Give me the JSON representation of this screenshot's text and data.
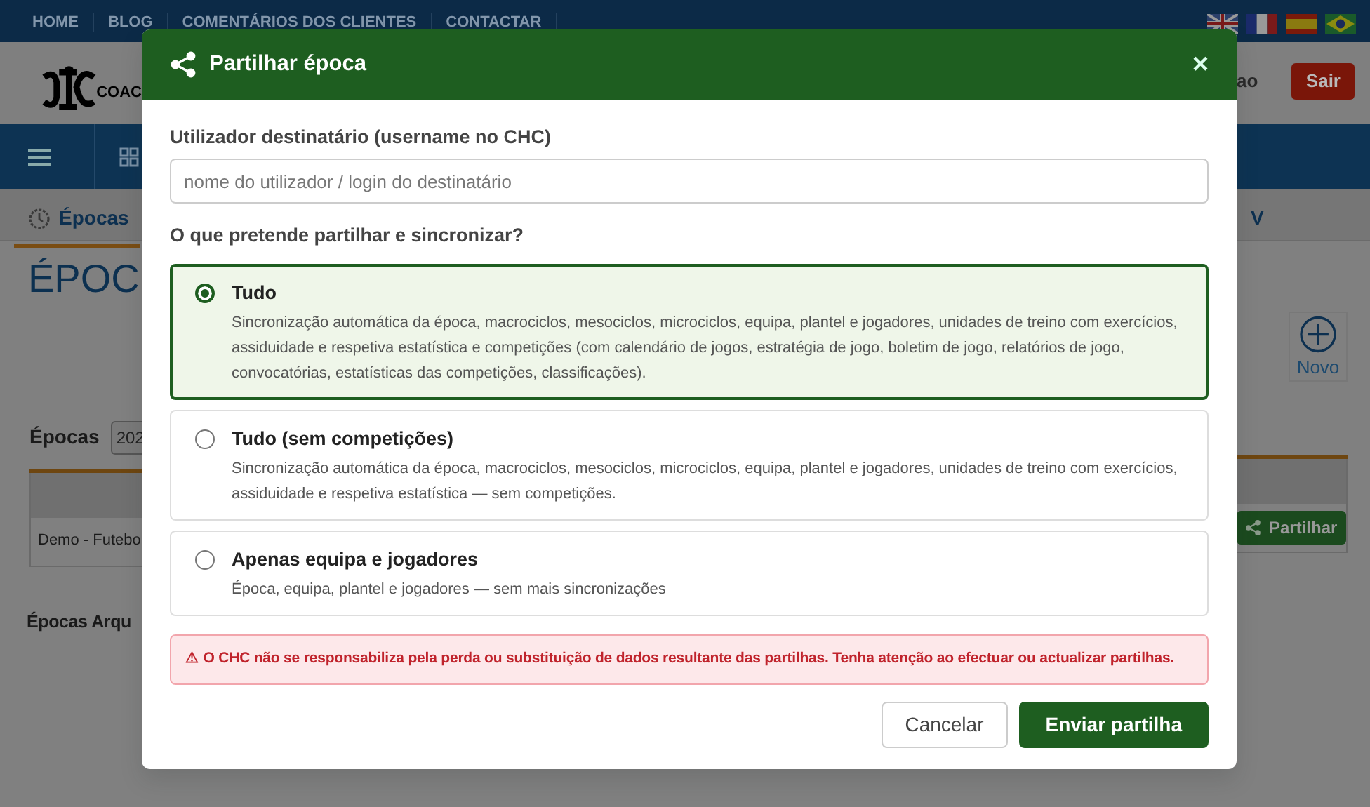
{
  "top_nav": {
    "links": [
      "HOME",
      "BLOG",
      "COMENTÁRIOS DOS CLIENTES",
      "CONTACTAR"
    ]
  },
  "header": {
    "logo_text": "COAC",
    "user_text": "ao",
    "logout_button": "Sair"
  },
  "tabs": [
    {
      "label": "Épocas",
      "selected": true
    },
    {
      "label": "V",
      "selected": false
    }
  ],
  "page": {
    "heading": "ÉPOC",
    "new_button": "Novo",
    "season_label": "Épocas",
    "season_select": "202",
    "table": {
      "rows": [
        {
          "name": "Demo - Futebo",
          "action": "Partilhar"
        }
      ]
    },
    "archived_heading": "Épocas Arqu"
  },
  "modal": {
    "title": "Partilhar época",
    "close": "×",
    "recipient": {
      "label": "Utilizador destinatário (username no CHC)",
      "placeholder": "nome do utilizador / login do destinatário"
    },
    "options_label": "O que pretende partilhar e sincronizar?",
    "options": [
      {
        "title": "Tudo",
        "description": "Sincronização automática da época, macrociclos, mesociclos, microciclos, equipa, plantel e jogadores, unidades de treino com exercícios, assiduidade e respetiva estatística e competições (com calendário de jogos, estratégia de jogo, boletim de jogo, relatórios de jogo, convocatórias, estatísticas das competições, classificações).",
        "selected": true
      },
      {
        "title": "Tudo (sem competições)",
        "description": "Sincronização automática da época, macrociclos, mesociclos, microciclos, equipa, plantel e jogadores, unidades de treino com exercícios, assiduidade e respetiva estatística — sem competições.",
        "selected": false
      },
      {
        "title": "Apenas equipa e jogadores",
        "description": "Época, equipa, plantel e jogadores — sem mais sincronizações",
        "selected": false
      }
    ],
    "warning": "⚠ O CHC não se responsabiliza pela perda ou substituição de dados resultante das partilhas. Tenha atenção ao efectuar ou actualizar partilhas.",
    "buttons": [
      {
        "label": "Cancelar",
        "kind": "secondary"
      },
      {
        "label": "Enviar partilha",
        "kind": "primary"
      }
    ]
  }
}
